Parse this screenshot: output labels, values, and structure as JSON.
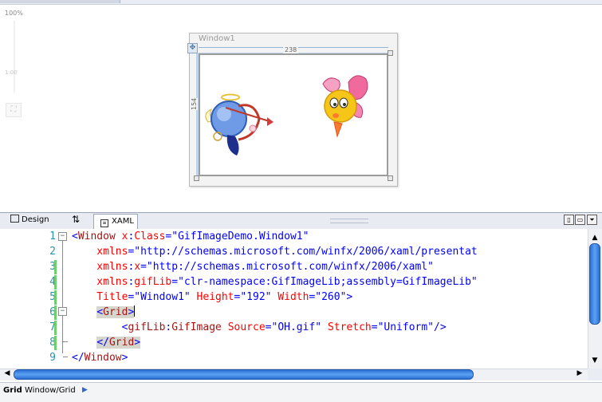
{
  "design": {
    "zoom_label": "100%",
    "zoom_mid_label": "1:00",
    "window_title": "Window1",
    "width_label": "238",
    "height_label": "154"
  },
  "tabs": {
    "design_label": "Design",
    "swap_label": "⇅",
    "xaml_label": "XAML"
  },
  "code": {
    "line_numbers": [
      "1",
      "2",
      "3",
      "4",
      "5",
      "6",
      "7",
      "8",
      "9"
    ],
    "lines": [
      [
        {
          "t": "<",
          "c": "br"
        },
        {
          "t": "Window ",
          "c": "el"
        },
        {
          "t": "x",
          "c": "at"
        },
        {
          "t": ":",
          "c": "br"
        },
        {
          "t": "Class",
          "c": "at"
        },
        {
          "t": "=\"GifImageDemo.Window1\"",
          "c": "val"
        }
      ],
      [
        {
          "t": "    xmlns",
          "c": "at"
        },
        {
          "t": "=\"http://schemas.microsoft.com/winfx/2006/xaml/presentat",
          "c": "val"
        }
      ],
      [
        {
          "t": "    xmlns",
          "c": "at"
        },
        {
          "t": ":",
          "c": "br"
        },
        {
          "t": "x",
          "c": "at"
        },
        {
          "t": "=\"http://schemas.microsoft.com/winfx/2006/xaml\"",
          "c": "val"
        }
      ],
      [
        {
          "t": "    xmlns",
          "c": "at"
        },
        {
          "t": ":",
          "c": "br"
        },
        {
          "t": "gifLib",
          "c": "at"
        },
        {
          "t": "=\"clr-namespace:GifImageLib;assembly=GifImageLib\"",
          "c": "val"
        }
      ],
      [
        {
          "t": "    Title",
          "c": "at"
        },
        {
          "t": "=\"Window1\" ",
          "c": "val"
        },
        {
          "t": "Height",
          "c": "at"
        },
        {
          "t": "=\"192\" ",
          "c": "val"
        },
        {
          "t": "Width",
          "c": "at"
        },
        {
          "t": "=\"260\">",
          "c": "val"
        }
      ],
      [
        {
          "t": "    ",
          "c": "br"
        },
        {
          "t": "<",
          "c": "br",
          "hl": true
        },
        {
          "t": "Grid",
          "c": "el",
          "hl": true
        },
        {
          "t": ">",
          "c": "br",
          "hl": true
        },
        {
          "t": "",
          "c": "cursor"
        }
      ],
      [
        {
          "t": "        <",
          "c": "br"
        },
        {
          "t": "gifLib",
          "c": "el"
        },
        {
          "t": ":",
          "c": "br"
        },
        {
          "t": "GifImage ",
          "c": "el"
        },
        {
          "t": "Source",
          "c": "at"
        },
        {
          "t": "=\"OH.gif\" ",
          "c": "val"
        },
        {
          "t": "Stretch",
          "c": "at"
        },
        {
          "t": "=\"Uniform\"/>",
          "c": "val"
        }
      ],
      [
        {
          "t": "    ",
          "c": "br"
        },
        {
          "t": "</",
          "c": "br",
          "hl": true
        },
        {
          "t": "Grid",
          "c": "el",
          "hl": true
        },
        {
          "t": ">",
          "c": "br",
          "hl": true
        }
      ],
      [
        {
          "t": "</",
          "c": "br"
        },
        {
          "t": "Window",
          "c": "el"
        },
        {
          "t": ">",
          "c": "br"
        }
      ]
    ]
  },
  "statusbar": {
    "element": "Grid",
    "path": "Window/Grid",
    "arrow": "▶"
  },
  "colors": {
    "line_number": "#2b91af",
    "element": "#a31515",
    "attribute": "#ff0000",
    "value": "#0000ff",
    "scroll_thumb": "#2a6fd6"
  }
}
